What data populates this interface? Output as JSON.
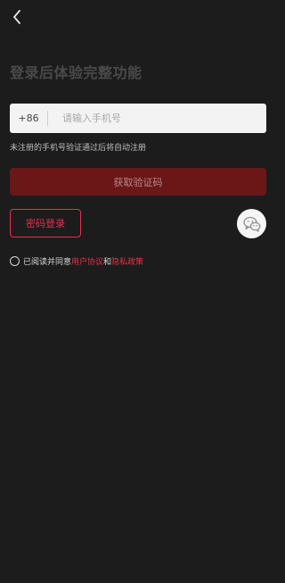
{
  "header": {
    "back_icon": "chevron-left-icon"
  },
  "title": "登录后体验完整功能",
  "phone": {
    "country_code": "+86",
    "value": "",
    "placeholder": "请输入手机号"
  },
  "hint": "未注册的手机号验证通过后将自动注册",
  "buttons": {
    "get_code": "获取验证码",
    "password_login": "密码登录",
    "wechat_icon": "wechat-icon"
  },
  "agreement": {
    "prefix": "已阅读并同意",
    "user_agreement": "用户协议",
    "and": "和",
    "privacy_policy": "隐私政策",
    "checked": false
  },
  "colors": {
    "background": "#1c1c1c",
    "accent": "#e8304e",
    "primary_button_disabled": "#6b1717"
  }
}
